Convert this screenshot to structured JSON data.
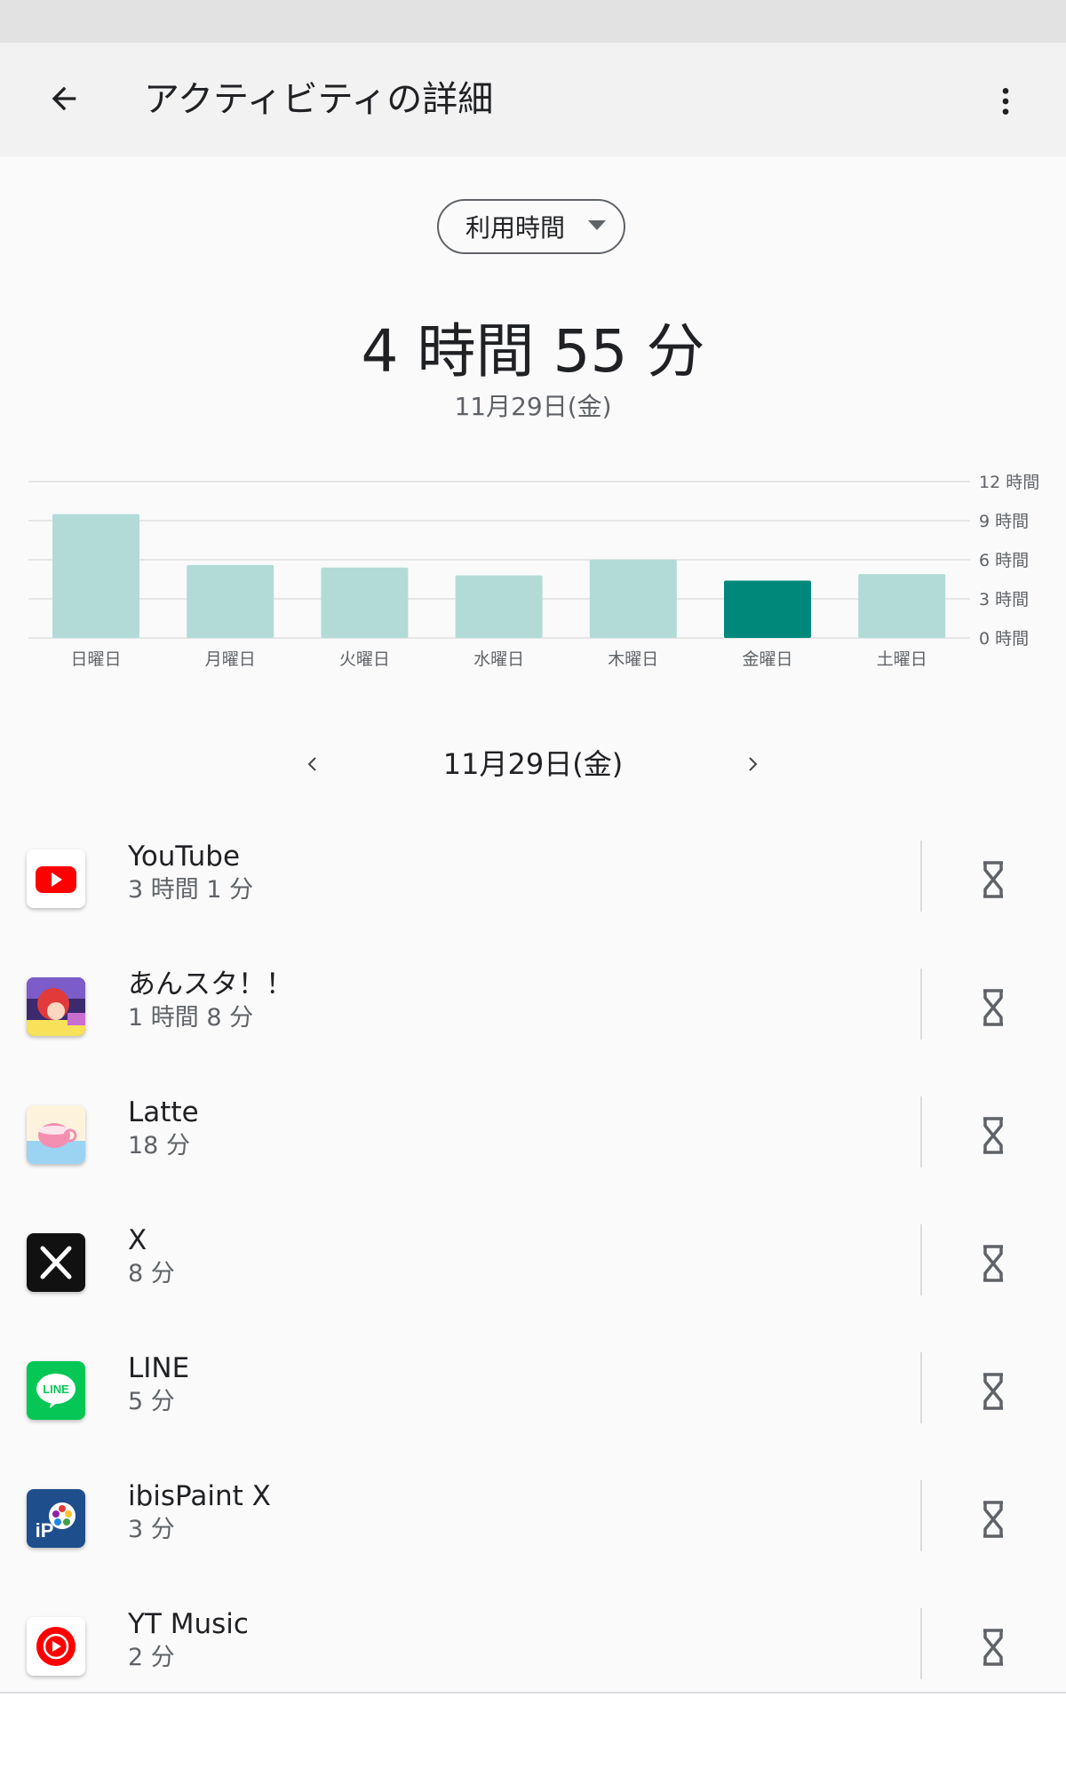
{
  "header": {
    "title": "アクティビティの詳細",
    "back_icon": "arrow-left-icon",
    "menu_icon": "more-vert-icon"
  },
  "metric_selector": {
    "selected": "利用時間"
  },
  "summary": {
    "total": "4 時間 55 分",
    "date": "11月29日(金)"
  },
  "chart_data": {
    "type": "bar",
    "categories": [
      "日曜日",
      "月曜日",
      "火曜日",
      "水曜日",
      "木曜日",
      "金曜日",
      "土曜日"
    ],
    "values": [
      9.5,
      5.6,
      5.4,
      4.8,
      6.0,
      4.4,
      4.9
    ],
    "selected_index": 5,
    "y_ticks": [
      {
        "value": 12,
        "label": "12 時間"
      },
      {
        "value": 9,
        "label": "9 時間"
      },
      {
        "value": 6,
        "label": "6 時間"
      },
      {
        "value": 3,
        "label": "3 時間"
      },
      {
        "value": 0,
        "label": "0 時間"
      }
    ],
    "ylim": [
      0,
      12
    ],
    "colors": {
      "bar": "#b2dbd6",
      "selected": "#00897b",
      "grid": "#e0e0e0"
    },
    "grid": true
  },
  "day_nav": {
    "date": "11月29日(金)",
    "prev_icon": "chevron-left-icon",
    "next_icon": "chevron-right-icon"
  },
  "apps": [
    {
      "name": "YouTube",
      "time": "3 時間 1 分",
      "icon": "youtube-icon"
    },
    {
      "name": "あんスタ！！",
      "time": "1 時間 8 分",
      "icon": "ensemble-stars-icon"
    },
    {
      "name": "Latte",
      "time": "18 分",
      "icon": "latte-cup-icon"
    },
    {
      "name": "X",
      "time": "8 分",
      "icon": "x-logo-icon"
    },
    {
      "name": "LINE",
      "time": "5 分",
      "icon": "line-icon"
    },
    {
      "name": "ibisPaint X",
      "time": "3 分",
      "icon": "ibispaint-icon"
    },
    {
      "name": "YT Music",
      "time": "2 分",
      "icon": "yt-music-icon"
    }
  ],
  "timer_icon": "hourglass-icon",
  "icon_logo_text": {
    "line": "LINE",
    "ibispaint": "iP"
  }
}
